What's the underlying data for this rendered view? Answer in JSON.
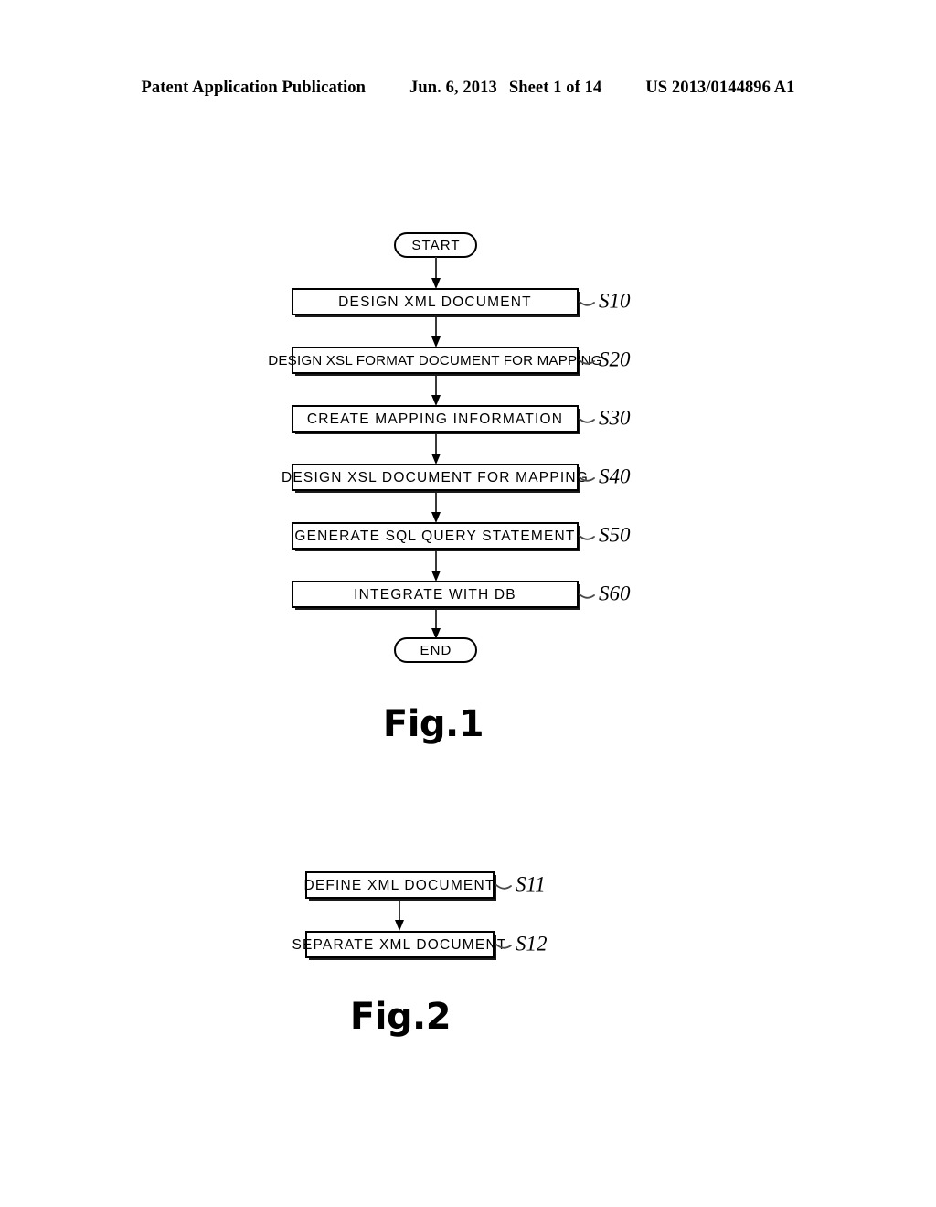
{
  "header": {
    "publication": "Patent Application Publication",
    "date": "Jun. 6, 2013",
    "sheet": "Sheet 1 of 14",
    "patent_number": "US 2013/0144896 A1"
  },
  "figures": [
    {
      "caption": "Fig.1",
      "start_label": "START",
      "end_label": "END",
      "steps": [
        {
          "text": "DESIGN XML DOCUMENT",
          "ref": "S10"
        },
        {
          "text": "DESIGN XSL FORMAT DOCUMENT FOR MAPPING",
          "ref": "S20"
        },
        {
          "text": "CREATE MAPPING INFORMATION",
          "ref": "S30"
        },
        {
          "text": "DESIGN XSL DOCUMENT FOR MAPPING",
          "ref": "S40"
        },
        {
          "text": "GENERATE SQL QUERY STATEMENT",
          "ref": "S50"
        },
        {
          "text": "INTEGRATE WITH DB",
          "ref": "S60"
        }
      ]
    },
    {
      "caption": "Fig.2",
      "steps": [
        {
          "text": "DEFINE XML DOCUMENT",
          "ref": "S11"
        },
        {
          "text": "SEPARATE XML DOCUMENT",
          "ref": "S12"
        }
      ]
    }
  ]
}
